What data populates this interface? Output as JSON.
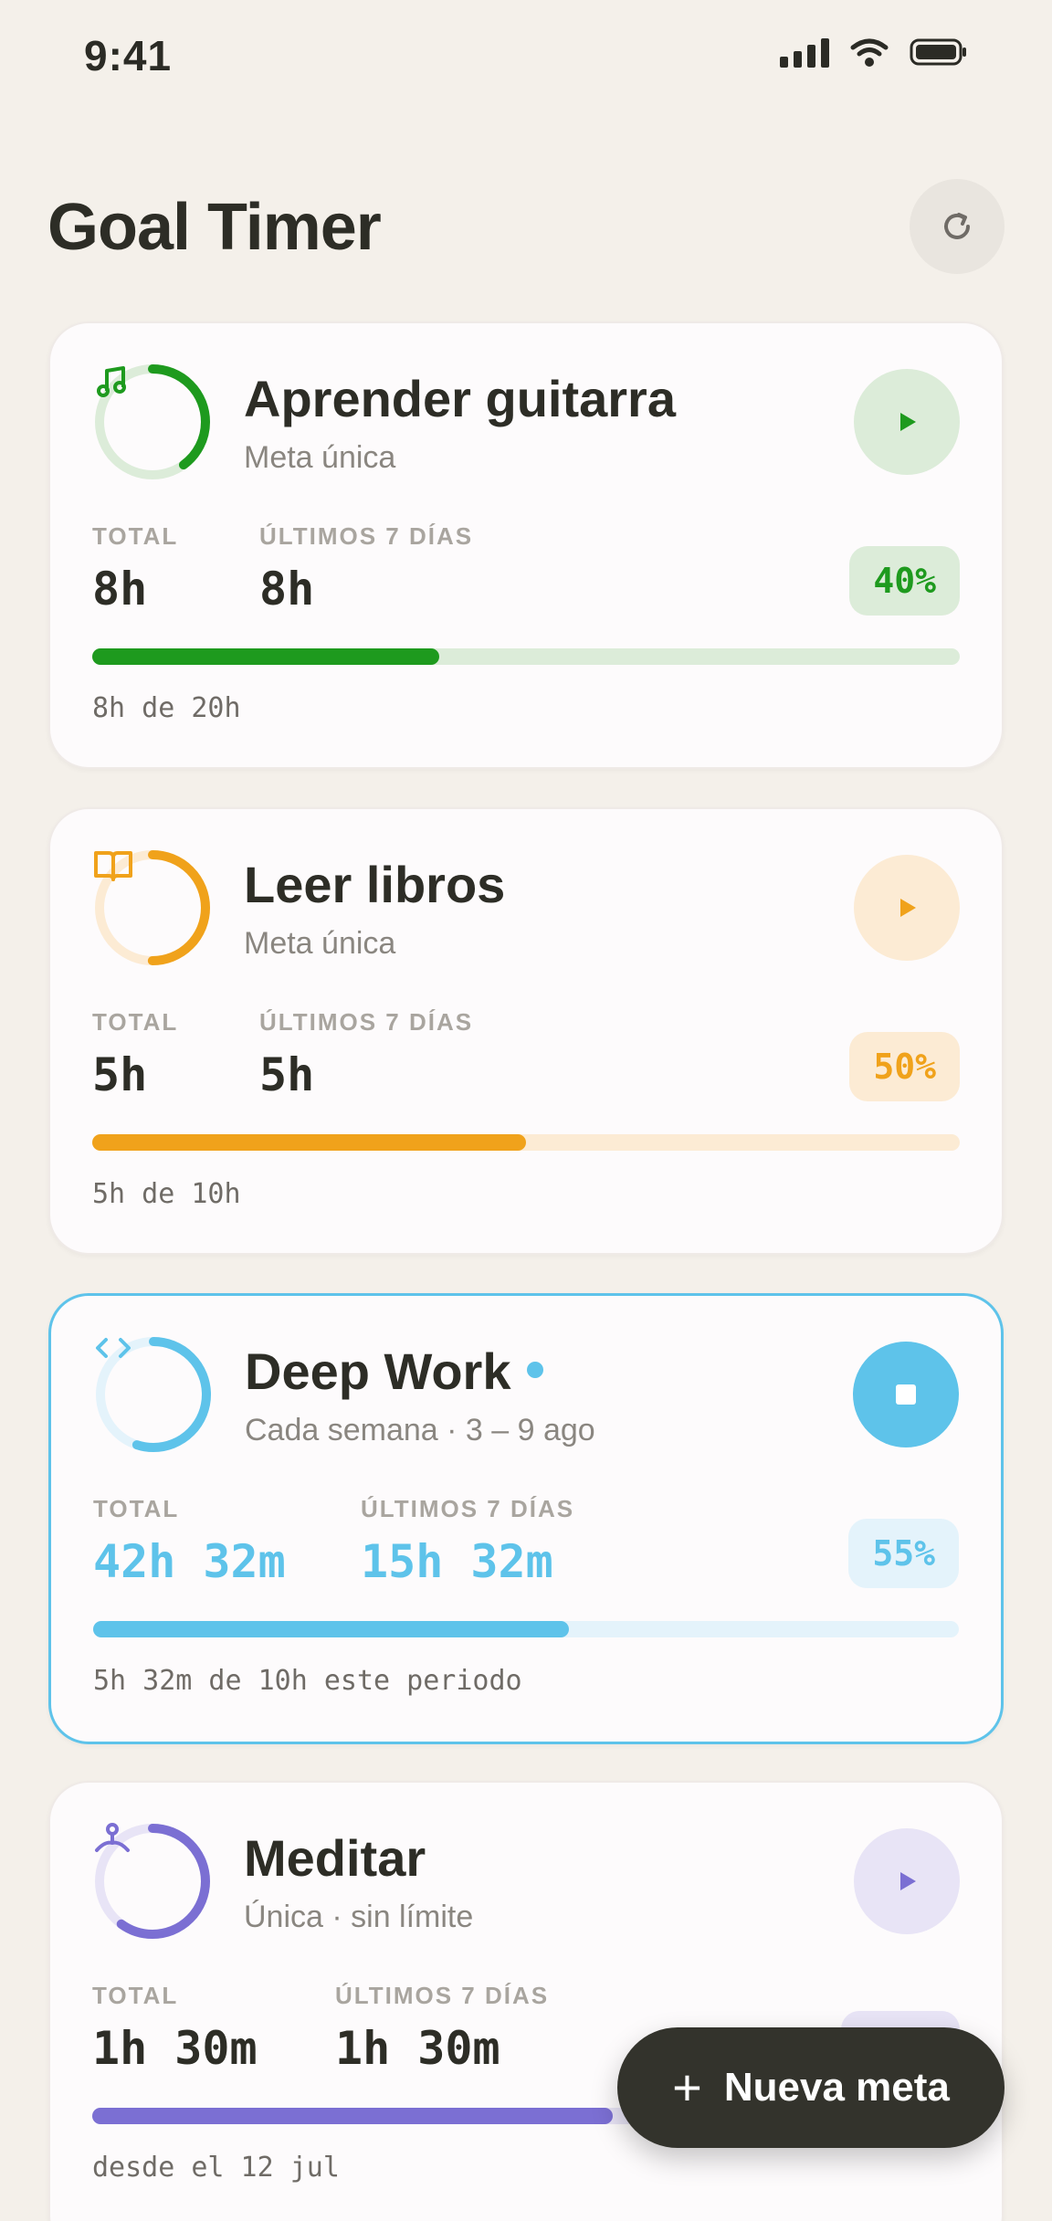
{
  "status_bar": {
    "time": "9:41"
  },
  "header": {
    "title": "Goal Timer"
  },
  "labels": {
    "total": "TOTAL",
    "last7": "ÚLTIMOS 7 DÍAS"
  },
  "goals": [
    {
      "title": "Aprender guitarra",
      "subtitle": "Meta única",
      "total": "8h",
      "last7": "8h",
      "percent_label": "40%",
      "progress": 0.4,
      "caption": "8h de 20h",
      "icon": "music-note-icon",
      "color": "#1e9a1e",
      "light": "#dcecd9",
      "state": "paused"
    },
    {
      "title": "Leer libros",
      "subtitle": "Meta única",
      "total": "5h",
      "last7": "5h",
      "percent_label": "50%",
      "progress": 0.5,
      "caption": "5h de 10h",
      "icon": "book-icon",
      "color": "#f0a21b",
      "light": "#fcebd4",
      "state": "paused"
    },
    {
      "title": "Deep Work",
      "subtitle": "Cada semana · 3 – 9 ago",
      "total": "42h 32m",
      "last7": "15h 32m",
      "percent_label": "55%",
      "progress": 0.55,
      "caption": "5h 32m de 10h este periodo",
      "icon": "code-icon",
      "color": "#5ec3ea",
      "light": "#e4f3fb",
      "state": "running"
    },
    {
      "title": "Meditar",
      "subtitle": "Única · sin límite",
      "total": "1h 30m",
      "last7": "1h 30m",
      "progress": 0.6,
      "caption": "desde el 12 jul",
      "icon": "meditation-icon",
      "color": "#7b6fd3",
      "light": "#e8e4f6",
      "state": "paused"
    }
  ],
  "fab": {
    "label": "Nueva meta"
  }
}
